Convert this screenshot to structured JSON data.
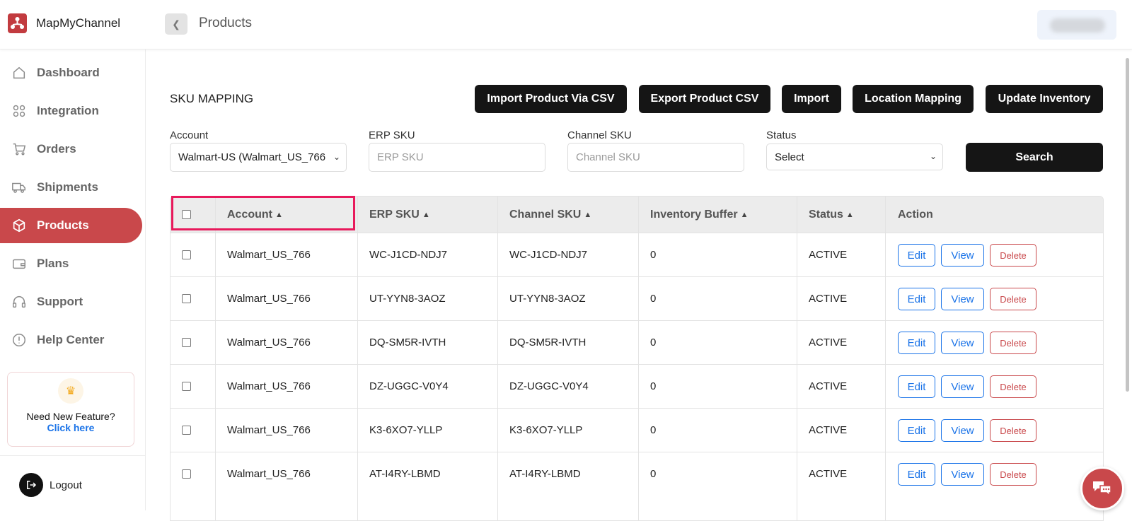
{
  "app": {
    "name": "MapMyChannel",
    "page_title": "Products"
  },
  "sidebar": {
    "items": [
      {
        "label": "Dashboard",
        "icon": "home-icon"
      },
      {
        "label": "Integration",
        "icon": "grid-icon"
      },
      {
        "label": "Orders",
        "icon": "cart-icon"
      },
      {
        "label": "Shipments",
        "icon": "truck-icon"
      },
      {
        "label": "Products",
        "icon": "box-icon",
        "active": true
      },
      {
        "label": "Plans",
        "icon": "wallet-icon"
      },
      {
        "label": "Support",
        "icon": "headset-icon"
      },
      {
        "label": "Help Center",
        "icon": "alert-circle-icon"
      }
    ],
    "feature_card": {
      "title": "Need New Feature?",
      "link": "Click here"
    },
    "logout_label": "Logout"
  },
  "main": {
    "section_title": "SKU MAPPING",
    "toolbar": {
      "import_csv": "Import Product Via CSV",
      "export_csv": "Export Product CSV",
      "import": "Import",
      "location_mapping": "Location Mapping",
      "update_inventory": "Update Inventory"
    },
    "filters": {
      "account_label": "Account",
      "account_value": "Walmart-US (Walmart_US_766",
      "erp_label": "ERP SKU",
      "erp_placeholder": "ERP SKU",
      "channel_label": "Channel SKU",
      "channel_placeholder": "Channel SKU",
      "status_label": "Status",
      "status_value": "Select",
      "search_label": "Search"
    },
    "table": {
      "headers": [
        "Account",
        "ERP SKU",
        "Channel SKU",
        "Inventory Buffer",
        "Status",
        "Action"
      ],
      "action_labels": {
        "edit": "Edit",
        "view": "View",
        "delete": "Delete"
      },
      "rows": [
        {
          "account": "Walmart_US_766",
          "erp_sku": "WC-J1CD-NDJ7",
          "channel_sku": "WC-J1CD-NDJ7",
          "buffer": "0",
          "status": "ACTIVE"
        },
        {
          "account": "Walmart_US_766",
          "erp_sku": "UT-YYN8-3AOZ",
          "channel_sku": "UT-YYN8-3AOZ",
          "buffer": "0",
          "status": "ACTIVE"
        },
        {
          "account": "Walmart_US_766",
          "erp_sku": "DQ-SM5R-IVTH",
          "channel_sku": "DQ-SM5R-IVTH",
          "buffer": "0",
          "status": "ACTIVE"
        },
        {
          "account": "Walmart_US_766",
          "erp_sku": "DZ-UGGC-V0Y4",
          "channel_sku": "DZ-UGGC-V0Y4",
          "buffer": "0",
          "status": "ACTIVE"
        },
        {
          "account": "Walmart_US_766",
          "erp_sku": "K3-6XO7-YLLP",
          "channel_sku": "K3-6XO7-YLLP",
          "buffer": "0",
          "status": "ACTIVE"
        },
        {
          "account": "Walmart_US_766",
          "erp_sku": "AT-I4RY-LBMD",
          "channel_sku": "AT-I4RY-LBMD",
          "buffer": "0",
          "status": "ACTIVE"
        }
      ]
    }
  },
  "colors": {
    "brand": "#c9484b",
    "dark_button": "#151515",
    "link": "#1a73e8",
    "highlight": "#e8195b"
  }
}
